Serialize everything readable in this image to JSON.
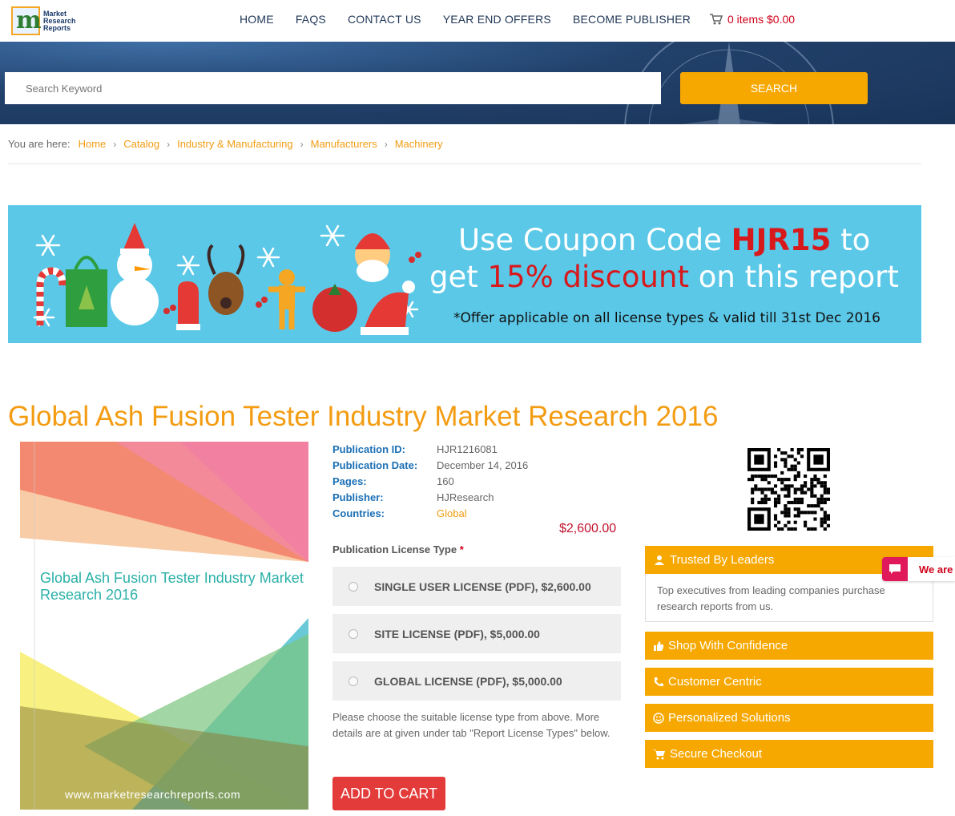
{
  "header": {
    "logo_lines": [
      "Market",
      "Research",
      "Reports"
    ],
    "nav": [
      "HOME",
      "FAQS",
      "CONTACT US",
      "YEAR END OFFERS",
      "BECOME PUBLISHER"
    ],
    "cart_text": "0 items $0.00"
  },
  "search": {
    "placeholder": "Search Keyword",
    "button": "SEARCH"
  },
  "breadcrumb": {
    "label": "You are here:",
    "items": [
      "Home",
      "Catalog",
      "Industry & Manufacturing",
      "Manufacturers",
      "Machinery"
    ]
  },
  "banner": {
    "line1_a": "Use Coupon Code ",
    "code": "HJR15",
    "line1_b": " to",
    "line2_a": "get ",
    "discount": "15% discount",
    "line2_b": " on this report",
    "line3": "*Offer applicable on all license types & valid till 31st Dec 2016"
  },
  "report": {
    "title": "Global Ash Fusion Tester Industry Market Research 2016",
    "cover_title": "Global Ash Fusion Tester Industry Market Research 2016",
    "cover_url": "www.marketresearchreports.com",
    "details": [
      {
        "k": "Publication ID:",
        "v": "HJR1216081"
      },
      {
        "k": "Publication Date:",
        "v": "December 14, 2016"
      },
      {
        "k": "Pages:",
        "v": "160"
      },
      {
        "k": "Publisher:",
        "v": "HJResearch"
      },
      {
        "k": "Countries:",
        "v": "Global"
      }
    ],
    "price": "$2,600.00",
    "license_label": "Publication License Type",
    "required_mark": "*",
    "licenses": [
      "SINGLE USER LICENSE (PDF), $2,600.00",
      "SITE LICENSE (PDF), $5,000.00",
      "GLOBAL LICENSE (PDF), $5,000.00"
    ],
    "note": "Please choose the suitable license type from above. More details are at given under tab \"Report License Types\" below.",
    "add_to_cart": "ADD TO CART"
  },
  "sidebar": {
    "trusted_title": "Trusted By Leaders",
    "trusted_body": "Top executives from leading companies purchase research reports from us.",
    "items": [
      "Shop With Confidence",
      "Customer Centric",
      "Personalized Solutions",
      "Secure Checkout"
    ]
  },
  "chat": {
    "label": "We are"
  },
  "colors": {
    "accent": "#f7a800",
    "link": "#f39c12",
    "navy": "#1f3656",
    "banner": "#5bc8e8",
    "cart_button": "#e33b3a"
  }
}
